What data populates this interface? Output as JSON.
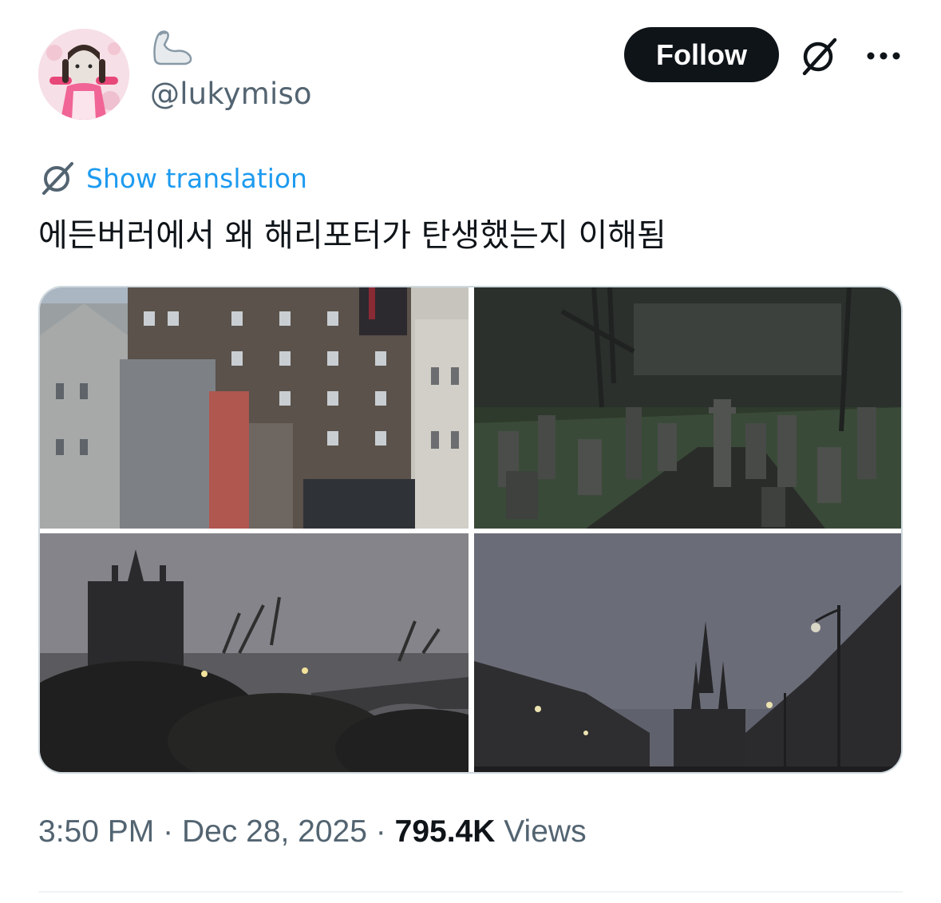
{
  "author": {
    "handle": "@lukymiso",
    "display_name_icon": "flexed-arm-emoji",
    "avatar_icon": "profile-avatar"
  },
  "header": {
    "follow_label": "Follow",
    "grok_icon": "grok-icon",
    "more_icon": "more-options-icon"
  },
  "tweet": {
    "translate_label": "Show translation",
    "text": "에든버러에서 왜 해리포터가 탄생했는지 이해됨",
    "media": [
      {
        "icon": "photo-old-town-buildings"
      },
      {
        "icon": "photo-graveyard"
      },
      {
        "icon": "photo-church-bridge"
      },
      {
        "icon": "photo-street-spire"
      }
    ]
  },
  "meta": {
    "time": "3:50 PM",
    "date": "Dec 28, 2025",
    "separator": "·",
    "views_count": "795.4K",
    "views_label": "Views"
  },
  "colors": {
    "link": "#1d9bf0",
    "secondary_text": "#536471",
    "primary_text": "#0f1419",
    "follow_bg": "#0f1419"
  }
}
